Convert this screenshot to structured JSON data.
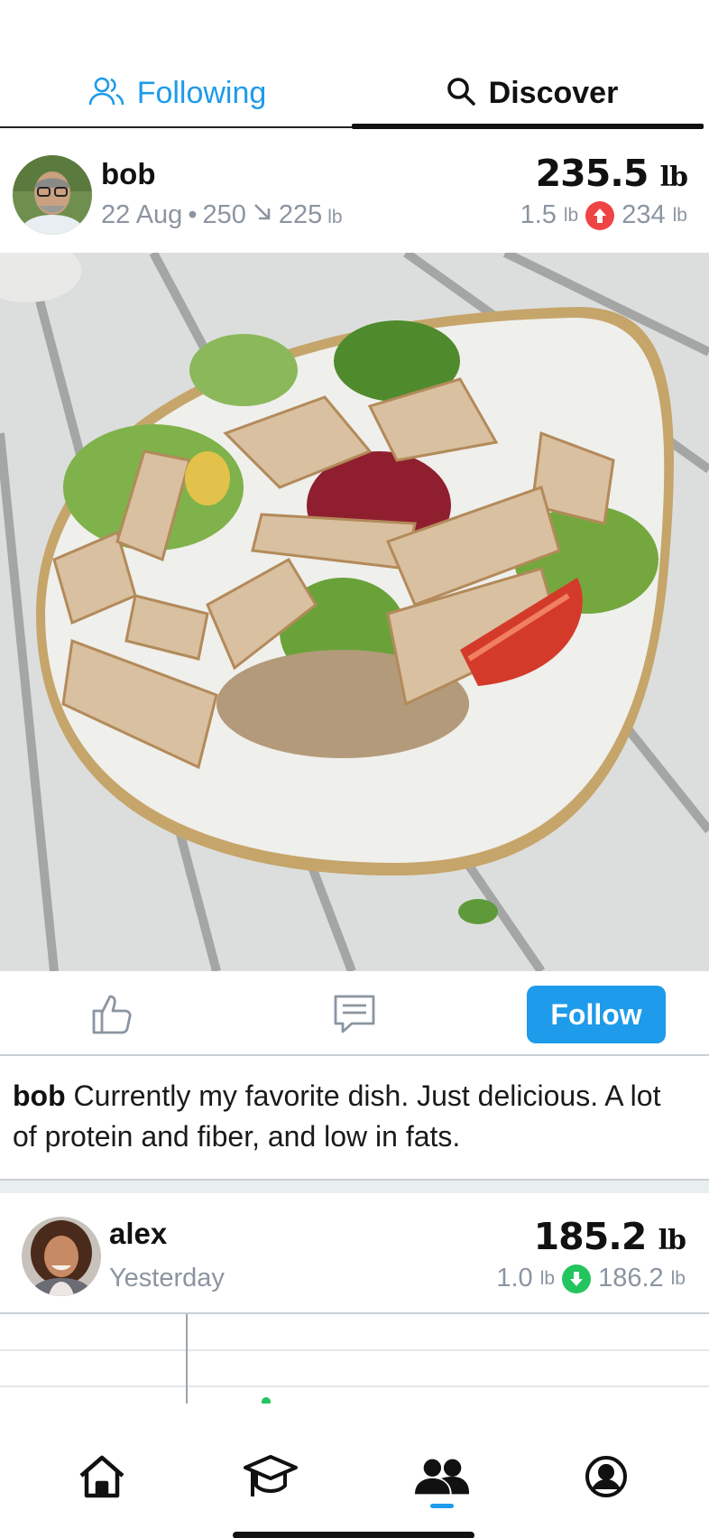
{
  "tabs": {
    "following_label": "Following",
    "discover_label": "Discover",
    "active": "Discover"
  },
  "posts": [
    {
      "username": "bob",
      "date": "22 Aug",
      "start_weight": "250",
      "goal_weight": "225",
      "unit": "lb",
      "current_weight": "235.5",
      "change_amount": "1.5",
      "change_direction": "up",
      "previous_weight": "234",
      "actions": {
        "follow_label": "Follow"
      },
      "caption_user": "bob",
      "caption_text": "Currently my favorite dish. Just delicious. A lot of protein and fiber, and low in fats."
    },
    {
      "username": "alex",
      "date": "Yesterday",
      "unit": "lb",
      "current_weight": "185.2",
      "change_amount": "1.0",
      "change_direction": "down",
      "previous_weight": "186.2"
    }
  ],
  "bottom_nav": {
    "items": [
      "home-icon",
      "graduation-cap-icon",
      "community-icon",
      "profile-icon"
    ],
    "active": "community-icon"
  },
  "colors": {
    "accent": "#1e9bea",
    "increase": "#ef4444",
    "decrease": "#22c55e"
  }
}
